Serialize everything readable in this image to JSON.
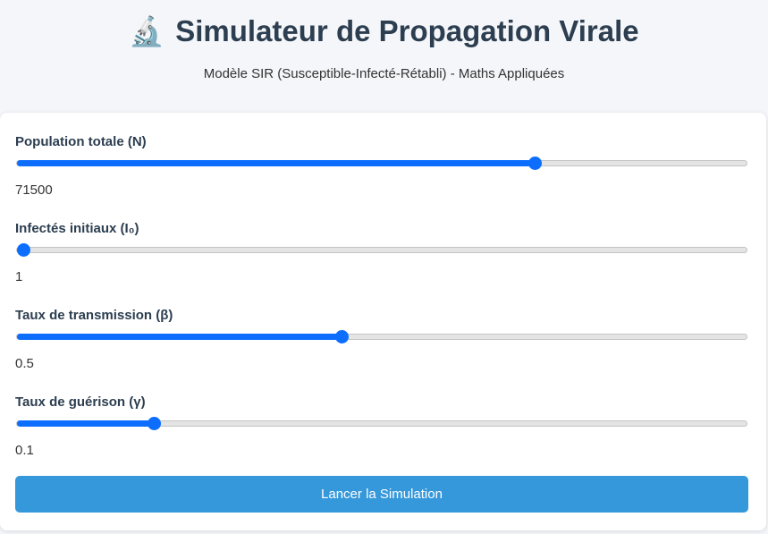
{
  "header": {
    "icon": "microscope-icon",
    "title": "Simulateur de Propagation Virale",
    "subtitle": "Modèle SIR (Susceptible-Infecté-Rétabli) - Maths Appliquées"
  },
  "controls": [
    {
      "label": "Population totale (N)",
      "value": "71500",
      "fraction": 0.71
    },
    {
      "label": "Infectés initiaux (I₀)",
      "value": "1",
      "fraction": 0.0
    },
    {
      "label": "Taux de transmission (β)",
      "value": "0.5",
      "fraction": 0.445
    },
    {
      "label": "Taux de guérison (γ)",
      "value": "0.1",
      "fraction": 0.188
    }
  ],
  "actions": {
    "run_label": "Lancer la Simulation"
  },
  "colors": {
    "accent": "#0d6efd",
    "button": "#3498db",
    "title": "#2c3e50",
    "background": "#f4f6f9"
  }
}
